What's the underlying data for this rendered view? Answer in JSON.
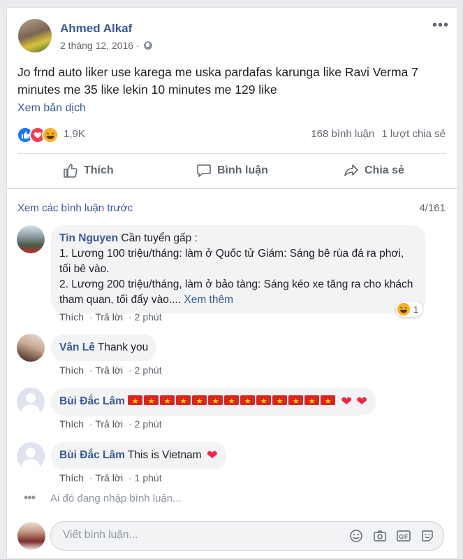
{
  "post": {
    "author": "Ahmed Alkaf",
    "date": "2 tháng 12, 2016 ·",
    "text": "Jo frnd auto liker use karega me uska pardafas karunga like Ravi Verma 7 minutes me 35 like lekin 10 minutes me 129 like",
    "translate": "Xem bản dịch",
    "reaction_count": "1,9K",
    "comments_count": "168 bình luận",
    "shares_count": "1 lượt chia sẻ"
  },
  "actions": {
    "like": "Thích",
    "comment": "Bình luận",
    "share": "Chia sẻ"
  },
  "comments_section": {
    "previous": "Xem các bình luận trước",
    "count": "4/161",
    "comments": [
      {
        "name": "Tin Nguyen",
        "text1": "Cần tuyển gấp :",
        "text2": "1. Lương 100 triệu/tháng: làm ở Quốc tử Giám: Sáng bê rùa đá ra phơi, tối bê vào.",
        "text3": "2. Lương 200 triệu/tháng, làm ở bảo tàng: Sáng kéo xe tăng ra cho khách tham quan, tối đẩy vào.... ",
        "see_more": "Xem thêm",
        "like": "Thích",
        "reply": "Trả lời",
        "time": "2 phút",
        "reaction_count": "1"
      },
      {
        "name": "Vân Lê",
        "text": "Thank you",
        "like": "Thích",
        "reply": "Trả lời",
        "time": "2 phút"
      },
      {
        "name": "Bùi Đắc Lâm",
        "flags_count": 13,
        "hearts_count": 2,
        "like": "Thích",
        "reply": "Trả lời",
        "time": "2 phút"
      },
      {
        "name": "Bùi Đắc Lâm",
        "text": "This is Vietnam",
        "like": "Thích",
        "reply": "Trả lời",
        "time": "1 phút"
      }
    ],
    "typing": "Ai đó đang nhập bình luận...",
    "composer_placeholder": "Viết bình luận..."
  }
}
